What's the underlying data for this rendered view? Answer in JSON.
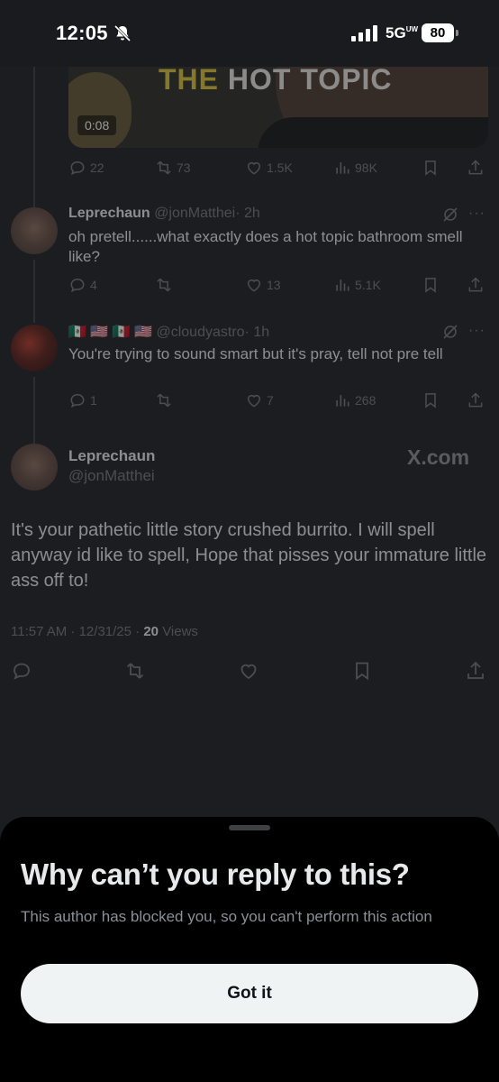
{
  "status_bar": {
    "time": "12:05",
    "network": "5G",
    "network_sub": "UW",
    "battery": "80"
  },
  "media_post": {
    "video_title_part1": "THE",
    "video_title_part2": "HOT TOPIC",
    "duration": "0:08",
    "replies": "22",
    "reposts": "73",
    "likes": "1.5K",
    "views": "98K"
  },
  "reply_1": {
    "name": "Leprechaun",
    "handle": "@jonMatthei",
    "time": "· 2h",
    "text": "oh pretell......what exactly does a hot topic bathroom smell like?",
    "replies": "4",
    "reposts": "",
    "likes": "13",
    "views": "5.1K"
  },
  "reply_2": {
    "name": "🇲🇽 🇺🇸 🇲🇽 🇺🇸",
    "handle": "@cloudyastro",
    "time": "· 1h",
    "text": "You're trying to sound smart but it's pray, tell not pre tell",
    "replies": "1",
    "reposts": "",
    "likes": "7",
    "views": "268"
  },
  "main_post": {
    "name": "Leprechaun",
    "handle": "@jonMatthei",
    "watermark": "X.com",
    "text": "It's your pathetic little story crushed burrito. I will spell anyway id like to spell, Hope that pisses your immature little ass off to!",
    "timestamp": "11:57 AM · 12/31/25 ·",
    "views_count": "20",
    "views_label": "Views"
  },
  "sheet": {
    "title": "Why can’t you reply to this?",
    "description": "This author has blocked you, so you can't perform this action",
    "button_label": "Got it"
  },
  "colors": {
    "background": "#1c1d20",
    "sheet": "#000000",
    "muted": "#71767b",
    "button_bg": "#eff3f4"
  }
}
